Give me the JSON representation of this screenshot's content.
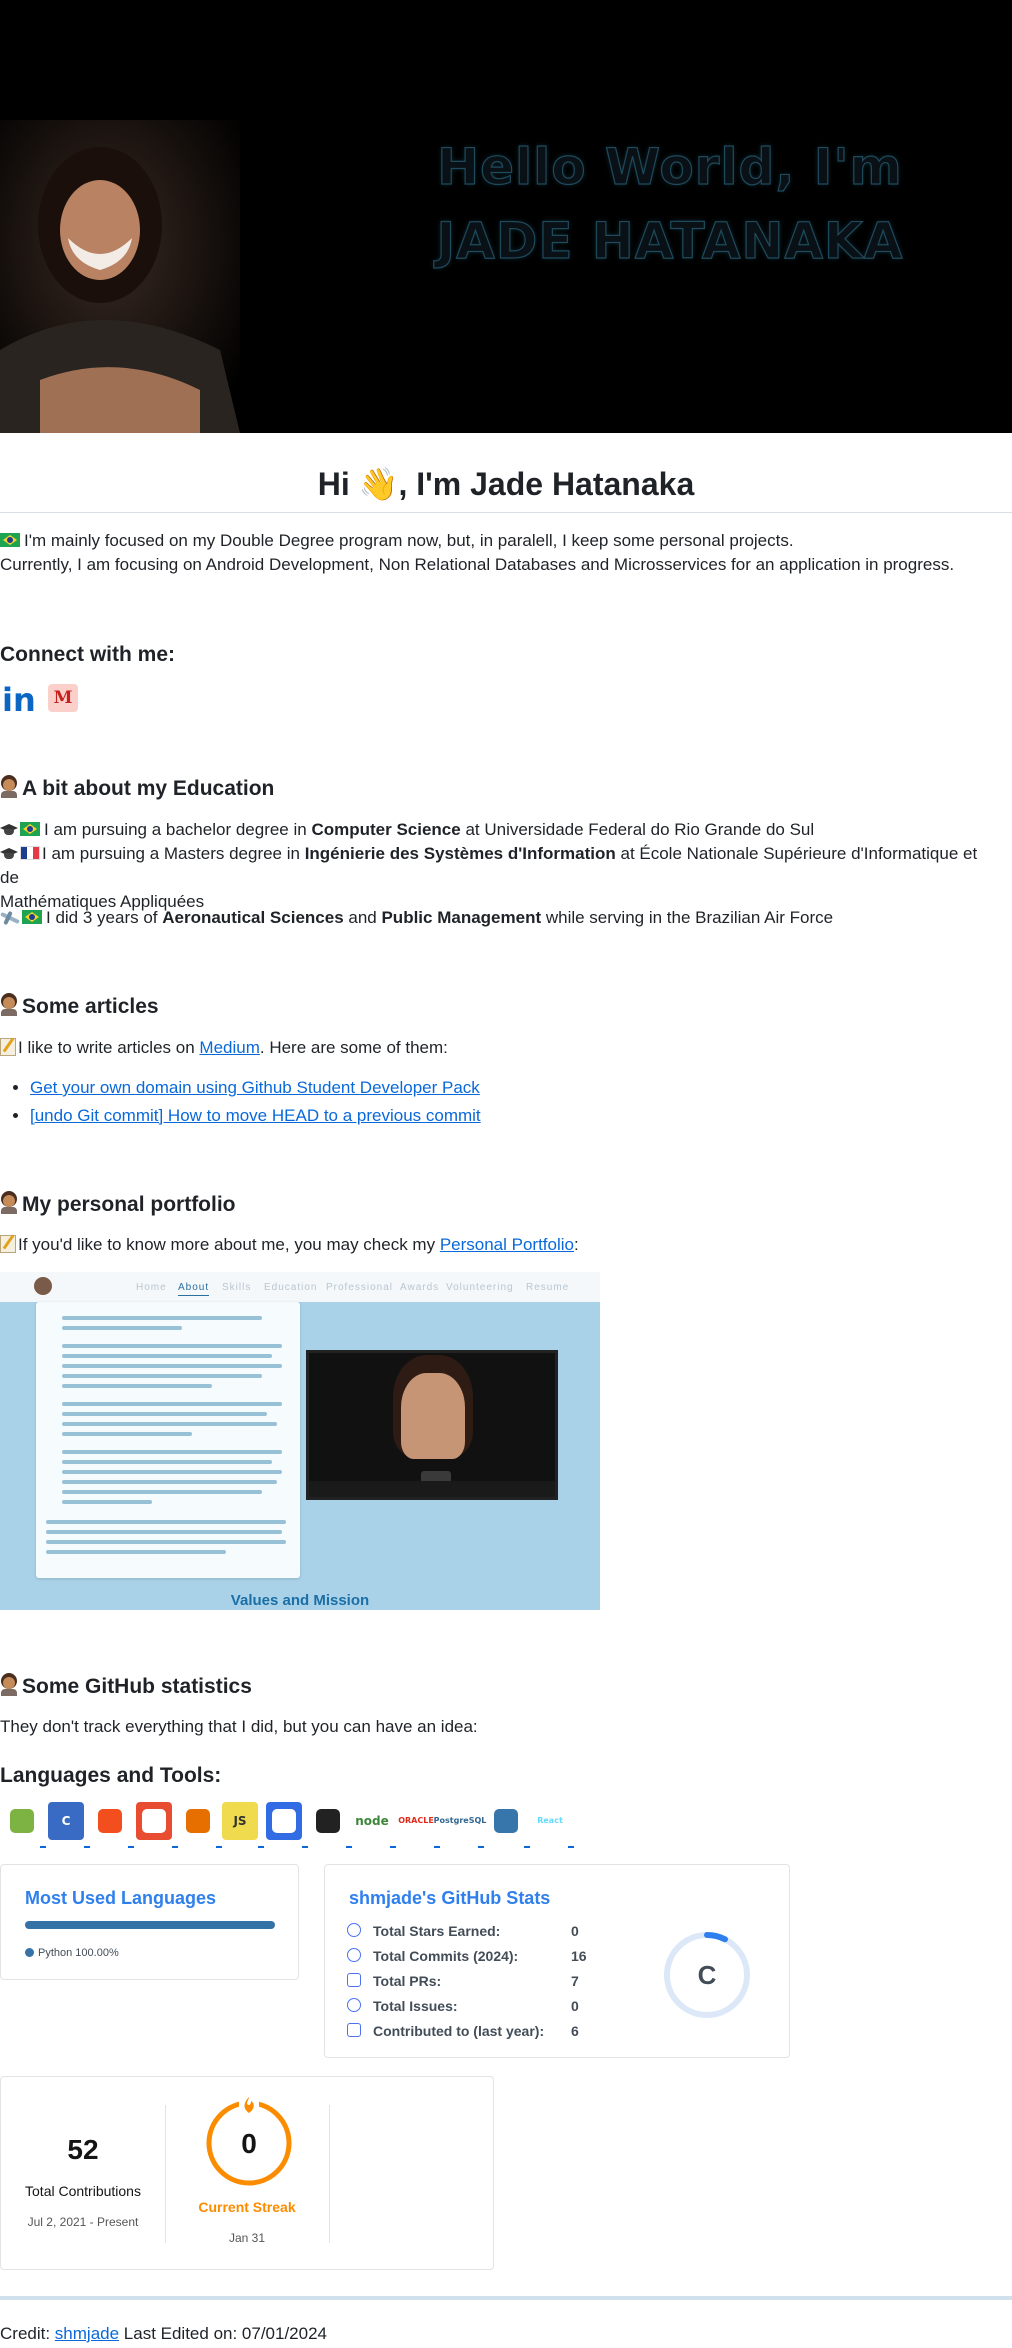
{
  "banner": {
    "line1": "Hello World, I'm",
    "line2": "JADE HATANAKA"
  },
  "title": {
    "text": "Hi",
    "name": ", I'm Jade Hatanaka"
  },
  "intro": {
    "line1": "I'm mainly focused on my Double Degree program now, but, in paralell, I keep some personal projects.",
    "line2": "Currently, I am focusing on Android Development, Non Relational Databases and Microsservices for an application in progress."
  },
  "connect": {
    "heading": "Connect with me:",
    "linkedin_text": "in",
    "gmail_text": "M"
  },
  "education": {
    "heading": "A bit about my Education",
    "bachelor": {
      "pre": "I am pursuing a bachelor degree in ",
      "bold": "Computer Science",
      "post": " at Universidade Federal do Rio Grande do Sul"
    },
    "masters": {
      "pre": "I am pursuing a Masters degree in ",
      "bold": "Ingénierie des Systèmes d'Information",
      "post1": " at École Nationale Supérieure d'Informatique et de",
      "post2": "Mathématiques Appliquées"
    },
    "airforce": {
      "pre": "I did 3 years of ",
      "bold1": "Aeronautical Sciences",
      "mid": " and ",
      "bold2": "Public Management",
      "post": " while serving in the Brazilian Air Force"
    }
  },
  "articles": {
    "heading": "Some articles",
    "intro_pre": "I like to write articles on ",
    "intro_link": "Medium",
    "intro_post": ". Here are some of them:",
    "items": [
      "Get your own domain using Github Student Developer Pack",
      "[undo Git commit] How to move HEAD to a previous commit"
    ]
  },
  "portfolio": {
    "heading": "My personal portfolio",
    "intro_pre": "If you'd like to know more about me, you may check my ",
    "intro_link": "Personal Portfolio",
    "intro_post": ":",
    "nav": [
      "Home",
      "About",
      "Skills",
      "Education",
      "Professional",
      "Awards",
      "Volunteering",
      "Resume"
    ],
    "caption": "Values and Mission"
  },
  "github": {
    "heading": "Some GitHub statistics",
    "subtitle": "They don't track everything that I did, but you can have an idea:"
  },
  "tools": {
    "heading": "Languages and Tools:",
    "items": [
      {
        "icon": "android-icon",
        "label": "",
        "bg": "#ffffff",
        "fg": "#7cb342"
      },
      {
        "icon": "c-icon",
        "label": "C",
        "bg": "#3a6bc4",
        "fg": "#ffffff"
      },
      {
        "icon": "figma-icon",
        "label": "",
        "bg": "#ffffff",
        "fg": "#f24e1e"
      },
      {
        "icon": "git-icon",
        "label": "",
        "bg": "#e84d31",
        "fg": "#ffffff"
      },
      {
        "icon": "java-icon",
        "label": "",
        "bg": "#ffffff",
        "fg": "#e76f00"
      },
      {
        "icon": "javascript-icon",
        "label": "JS",
        "bg": "#f0db4f",
        "fg": "#323330"
      },
      {
        "icon": "kubernetes-icon",
        "label": "",
        "bg": "#326ce5",
        "fg": "#ffffff"
      },
      {
        "icon": "linux-icon",
        "label": "",
        "bg": "#ffffff",
        "fg": "#222222"
      },
      {
        "icon": "nodejs-icon",
        "label": "node",
        "bg": "#ffffff",
        "fg": "#3c873a"
      },
      {
        "icon": "oracle-icon",
        "label": "ORACLE",
        "bg": "#ffffff",
        "fg": "#e22a1a"
      },
      {
        "icon": "postgresql-icon",
        "label": "PostgreSQL",
        "bg": "#ffffff",
        "fg": "#336791"
      },
      {
        "icon": "python-icon",
        "label": "",
        "bg": "#ffffff",
        "fg": "#3776ab"
      },
      {
        "icon": "react-icon",
        "label": "React",
        "bg": "#ffffff",
        "fg": "#61dafb"
      }
    ]
  },
  "most_used": {
    "title": "Most Used Languages",
    "language": "Python 100.00%",
    "percent": 100,
    "color": "#3572a5"
  },
  "stats": {
    "title": "shmjade's GitHub Stats",
    "rows": [
      {
        "icon": "star-icon",
        "label": "Total Stars Earned:",
        "value": "0"
      },
      {
        "icon": "history-icon",
        "label": "Total Commits (2024):",
        "value": "16"
      },
      {
        "icon": "pull-request-icon",
        "label": "Total PRs:",
        "value": "7"
      },
      {
        "icon": "issue-icon",
        "label": "Total Issues:",
        "value": "0"
      },
      {
        "icon": "repo-icon",
        "label": "Contributed to (last year):",
        "value": "6"
      }
    ],
    "rank": "C",
    "accent": "#2f80ed"
  },
  "streak": {
    "total_value": "52",
    "total_label": "Total Contributions",
    "total_range": "Jul 2, 2021 - Present",
    "current_value": "0",
    "current_label": "Current Streak",
    "current_date": "Jan 31",
    "accent": "#fb8c00"
  },
  "footer": {
    "credit": "Credit: ",
    "link": "shmjade",
    "edited": " Last Edited on: 07/01/2024"
  }
}
